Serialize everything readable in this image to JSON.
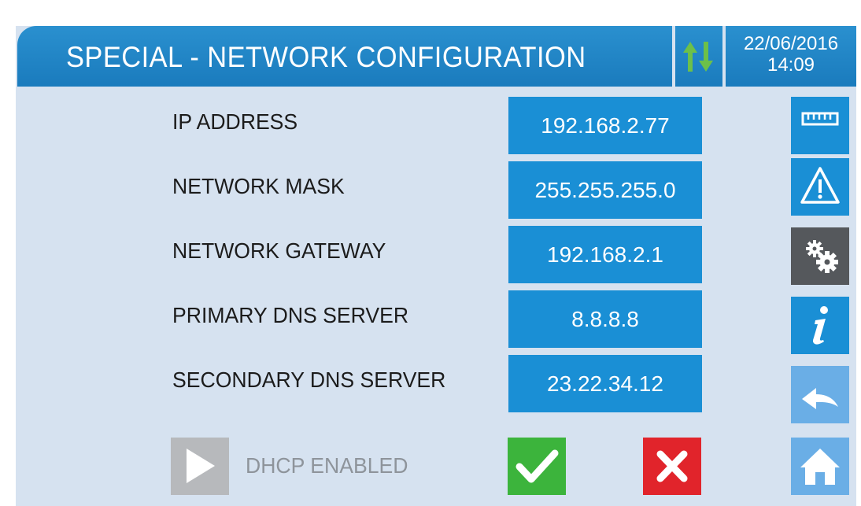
{
  "header": {
    "title": "SPECIAL - NETWORK CONFIGURATION",
    "date": "22/06/2016",
    "time": "14:09"
  },
  "fields": [
    {
      "label": "IP ADDRESS",
      "value": "192.168.2.77"
    },
    {
      "label": "NETWORK MASK",
      "value": "255.255.255.0"
    },
    {
      "label": "NETWORK GATEWAY",
      "value": "192.168.2.1"
    },
    {
      "label": "PRIMARY DNS SERVER",
      "value": "8.8.8.8"
    },
    {
      "label": "SECONDARY DNS SERVER",
      "value": "23.22.34.12"
    }
  ],
  "dhcp": {
    "label": "DHCP ENABLED",
    "enabled": false
  },
  "sidebar": {
    "items": [
      {
        "icon": "ruler-icon"
      },
      {
        "icon": "warning-icon"
      },
      {
        "icon": "gears-icon",
        "active": true
      },
      {
        "icon": "info-icon"
      },
      {
        "icon": "back-icon"
      },
      {
        "icon": "home-icon"
      }
    ]
  },
  "colors": {
    "accent": "#1a8fd5",
    "background": "#d6e2f0",
    "confirm": "#3cb43c",
    "cancel": "#e1242b",
    "active": "#55585c",
    "disabled": "#b7b9bc"
  }
}
